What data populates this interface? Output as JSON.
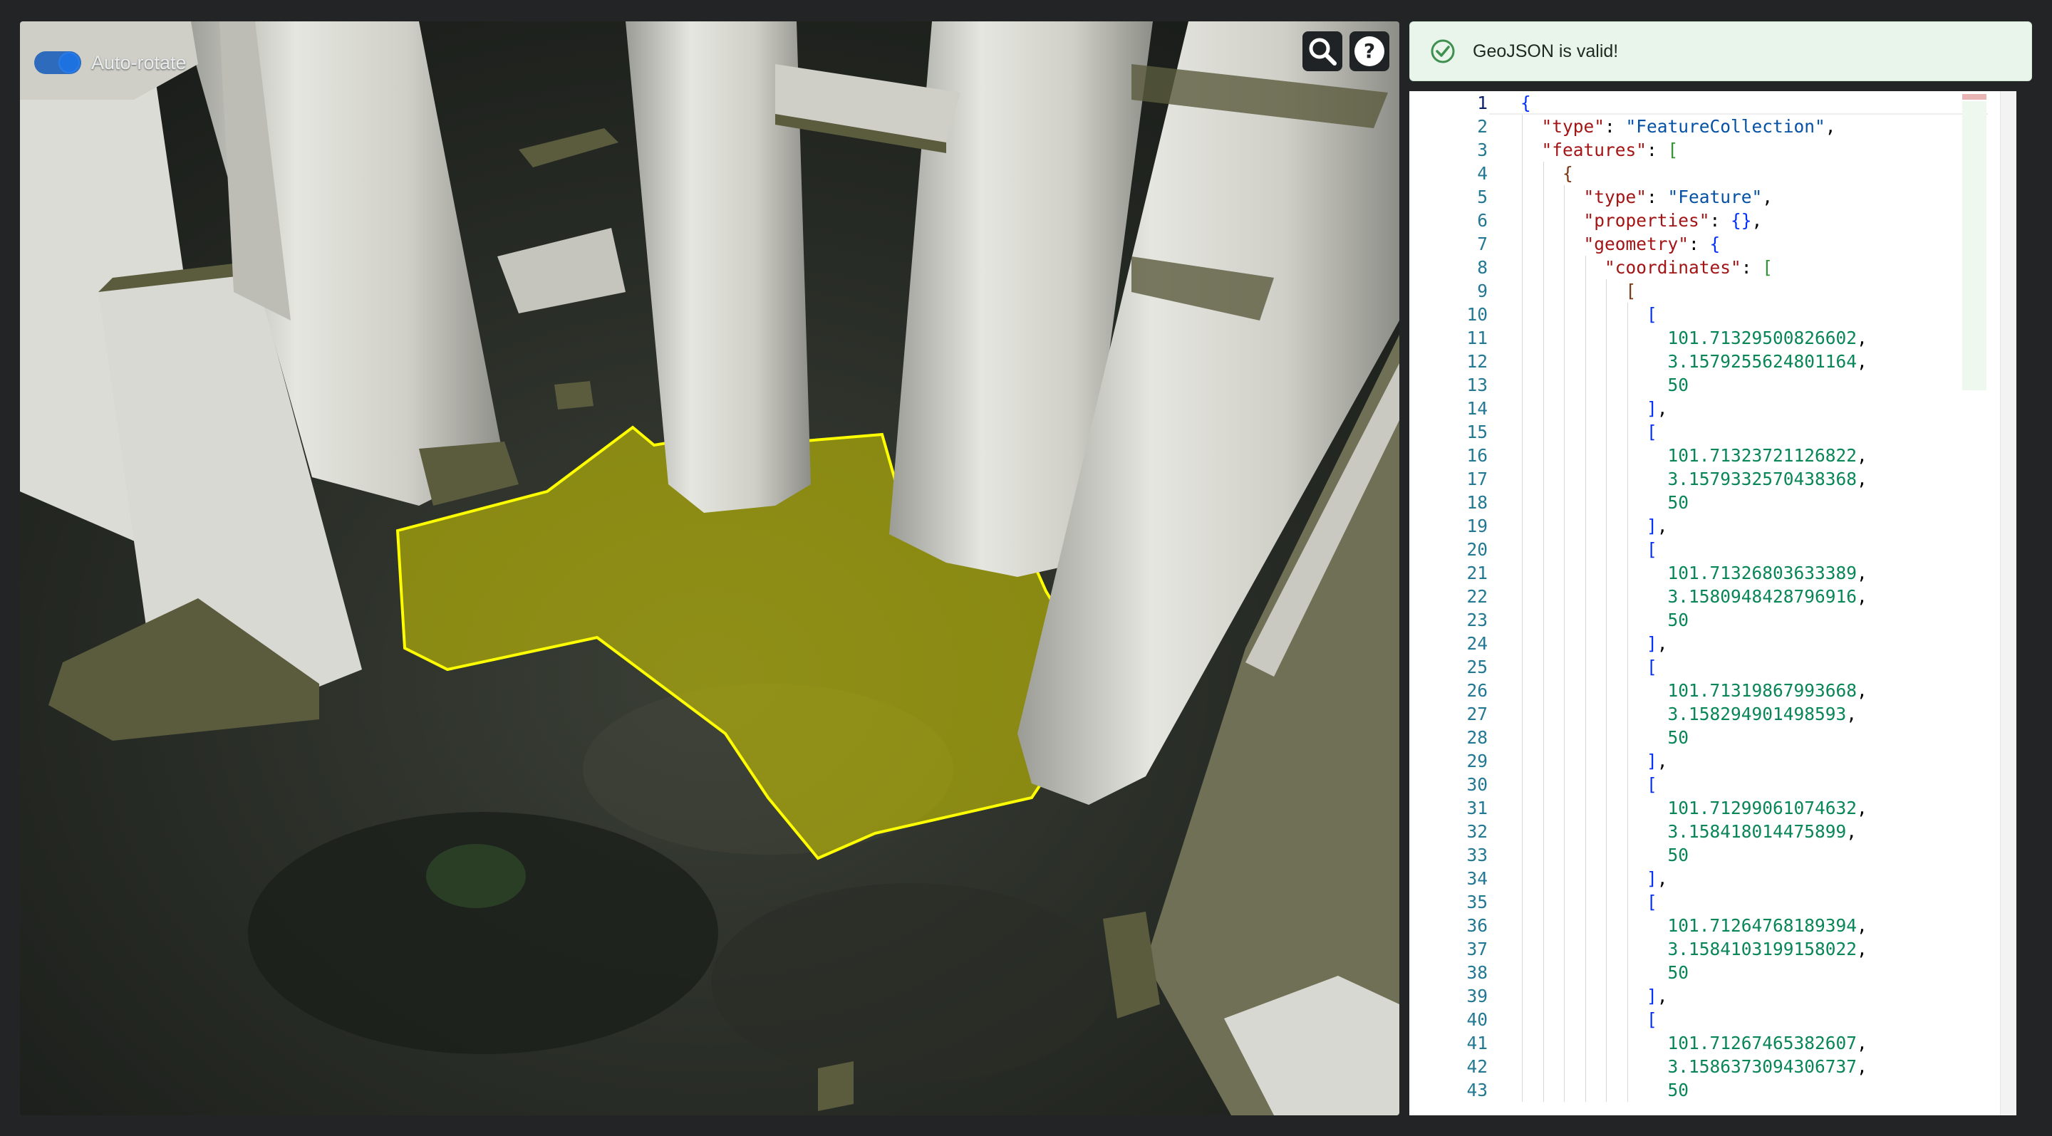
{
  "map": {
    "auto_rotate_label": "Auto-rotate",
    "auto_rotate_on": true,
    "search_icon": "search-icon",
    "help_icon": "help-icon",
    "polygon_color": "#ffff00",
    "building_light": "#dcdcd6",
    "building_roof": "#5a5a3c"
  },
  "alert": {
    "message": "GeoJSON is valid!",
    "icon": "check-circle-icon",
    "color": "#3f8f50"
  },
  "editor": {
    "active_line": 1,
    "lines": [
      {
        "n": "1",
        "t": [
          [
            "b1",
            "{"
          ]
        ]
      },
      {
        "n": "2",
        "t": [
          [
            "k",
            "\"type\""
          ],
          [
            "p",
            ": "
          ],
          [
            "s",
            "\"FeatureCollection\""
          ],
          [
            "p",
            ","
          ]
        ]
      },
      {
        "n": "3",
        "t": [
          [
            "k",
            "\"features\""
          ],
          [
            "p",
            ": "
          ],
          [
            "b2",
            "["
          ]
        ]
      },
      {
        "n": "4",
        "t": [
          [
            "b3",
            "{"
          ]
        ]
      },
      {
        "n": "5",
        "t": [
          [
            "k",
            "\"type\""
          ],
          [
            "p",
            ": "
          ],
          [
            "s",
            "\"Feature\""
          ],
          [
            "p",
            ","
          ]
        ]
      },
      {
        "n": "6",
        "t": [
          [
            "k",
            "\"properties\""
          ],
          [
            "p",
            ": "
          ],
          [
            "b1",
            "{}"
          ],
          [
            "p",
            ","
          ]
        ]
      },
      {
        "n": "7",
        "t": [
          [
            "k",
            "\"geometry\""
          ],
          [
            "p",
            ": "
          ],
          [
            "b1",
            "{"
          ]
        ]
      },
      {
        "n": "8",
        "t": [
          [
            "k",
            "\"coordinates\""
          ],
          [
            "p",
            ": "
          ],
          [
            "b2",
            "["
          ]
        ]
      },
      {
        "n": "9",
        "t": [
          [
            "b3",
            "["
          ]
        ]
      },
      {
        "n": "10",
        "t": [
          [
            "b1",
            "["
          ]
        ]
      },
      {
        "n": "11",
        "t": [
          [
            "n",
            "101.71329500826602"
          ],
          [
            "p",
            ","
          ]
        ]
      },
      {
        "n": "12",
        "t": [
          [
            "n",
            "3.1579255624801164"
          ],
          [
            "p",
            ","
          ]
        ]
      },
      {
        "n": "13",
        "t": [
          [
            "n",
            "50"
          ]
        ]
      },
      {
        "n": "14",
        "t": [
          [
            "b1",
            "]"
          ],
          [
            "p",
            ","
          ]
        ]
      },
      {
        "n": "15",
        "t": [
          [
            "b1",
            "["
          ]
        ]
      },
      {
        "n": "16",
        "t": [
          [
            "n",
            "101.71323721126822"
          ],
          [
            "p",
            ","
          ]
        ]
      },
      {
        "n": "17",
        "t": [
          [
            "n",
            "3.1579332570438368"
          ],
          [
            "p",
            ","
          ]
        ]
      },
      {
        "n": "18",
        "t": [
          [
            "n",
            "50"
          ]
        ]
      },
      {
        "n": "19",
        "t": [
          [
            "b1",
            "]"
          ],
          [
            "p",
            ","
          ]
        ]
      },
      {
        "n": "20",
        "t": [
          [
            "b1",
            "["
          ]
        ]
      },
      {
        "n": "21",
        "t": [
          [
            "n",
            "101.71326803633389"
          ],
          [
            "p",
            ","
          ]
        ]
      },
      {
        "n": "22",
        "t": [
          [
            "n",
            "3.1580948428796916"
          ],
          [
            "p",
            ","
          ]
        ]
      },
      {
        "n": "23",
        "t": [
          [
            "n",
            "50"
          ]
        ]
      },
      {
        "n": "24",
        "t": [
          [
            "b1",
            "]"
          ],
          [
            "p",
            ","
          ]
        ]
      },
      {
        "n": "25",
        "t": [
          [
            "b1",
            "["
          ]
        ]
      },
      {
        "n": "26",
        "t": [
          [
            "n",
            "101.71319867993668"
          ],
          [
            "p",
            ","
          ]
        ]
      },
      {
        "n": "27",
        "t": [
          [
            "n",
            "3.158294901498593"
          ],
          [
            "p",
            ","
          ]
        ]
      },
      {
        "n": "28",
        "t": [
          [
            "n",
            "50"
          ]
        ]
      },
      {
        "n": "29",
        "t": [
          [
            "b1",
            "]"
          ],
          [
            "p",
            ","
          ]
        ]
      },
      {
        "n": "30",
        "t": [
          [
            "b1",
            "["
          ]
        ]
      },
      {
        "n": "31",
        "t": [
          [
            "n",
            "101.71299061074632"
          ],
          [
            "p",
            ","
          ]
        ]
      },
      {
        "n": "32",
        "t": [
          [
            "n",
            "3.158418014475899"
          ],
          [
            "p",
            ","
          ]
        ]
      },
      {
        "n": "33",
        "t": [
          [
            "n",
            "50"
          ]
        ]
      },
      {
        "n": "34",
        "t": [
          [
            "b1",
            "]"
          ],
          [
            "p",
            ","
          ]
        ]
      },
      {
        "n": "35",
        "t": [
          [
            "b1",
            "["
          ]
        ]
      },
      {
        "n": "36",
        "t": [
          [
            "n",
            "101.71264768189394"
          ],
          [
            "p",
            ","
          ]
        ]
      },
      {
        "n": "37",
        "t": [
          [
            "n",
            "3.1584103199158022"
          ],
          [
            "p",
            ","
          ]
        ]
      },
      {
        "n": "38",
        "t": [
          [
            "n",
            "50"
          ]
        ]
      },
      {
        "n": "39",
        "t": [
          [
            "b1",
            "]"
          ],
          [
            "p",
            ","
          ]
        ]
      },
      {
        "n": "40",
        "t": [
          [
            "b1",
            "["
          ]
        ]
      },
      {
        "n": "41",
        "t": [
          [
            "n",
            "101.71267465382607"
          ],
          [
            "p",
            ","
          ]
        ]
      },
      {
        "n": "42",
        "t": [
          [
            "n",
            "3.1586373094306737"
          ],
          [
            "p",
            ","
          ]
        ]
      },
      {
        "n": "43",
        "t": [
          [
            "n",
            "50"
          ]
        ]
      }
    ]
  }
}
